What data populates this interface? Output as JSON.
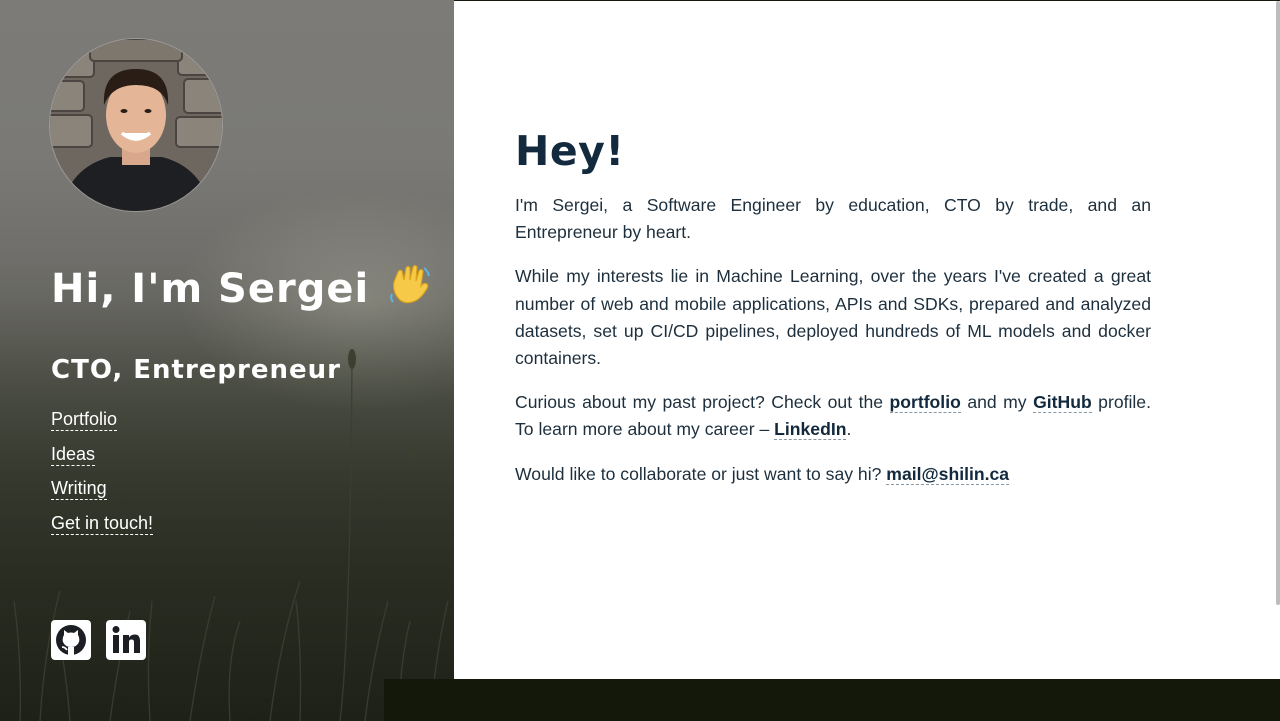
{
  "sidebar": {
    "greeting": "Hi, I'm Sergei",
    "greeting_emoji": "waving-hand-icon",
    "role": "CTO, Entrepreneur",
    "nav": [
      {
        "label": "Portfolio"
      },
      {
        "label": "Ideas"
      },
      {
        "label": "Writing"
      },
      {
        "label": "Get in touch!"
      }
    ],
    "social": [
      {
        "icon": "github-icon"
      },
      {
        "icon": "linkedin-icon"
      }
    ]
  },
  "main": {
    "heading": "Hey!",
    "p1": "I'm Sergei, a Software Engineer by education, CTO by trade, and an Entrepreneur by heart.",
    "p2": "While my interests lie in Machine Learning, over the years I've created a great number of web and mobile applications, APIs and SDKs, prepared and analyzed datasets, set up CI/CD pipelines, deployed hundreds of ML models and docker containers.",
    "p3": {
      "before_portfolio": "Curious about my past project? Check out the ",
      "portfolio_link": "portfolio",
      "between": " and my ",
      "github_link": "GitHub",
      "after_github": " profile. To learn more about my career – ",
      "linkedin_link": "LinkedIn",
      "end": "."
    },
    "p4": {
      "before_mail": "Would like to collaborate or just want to say hi? ",
      "mail_link": "mail@shilin.ca"
    }
  },
  "colors": {
    "heading": "#13293d",
    "body_text": "#1d2f3d",
    "sidebar_text": "#ffffff"
  }
}
